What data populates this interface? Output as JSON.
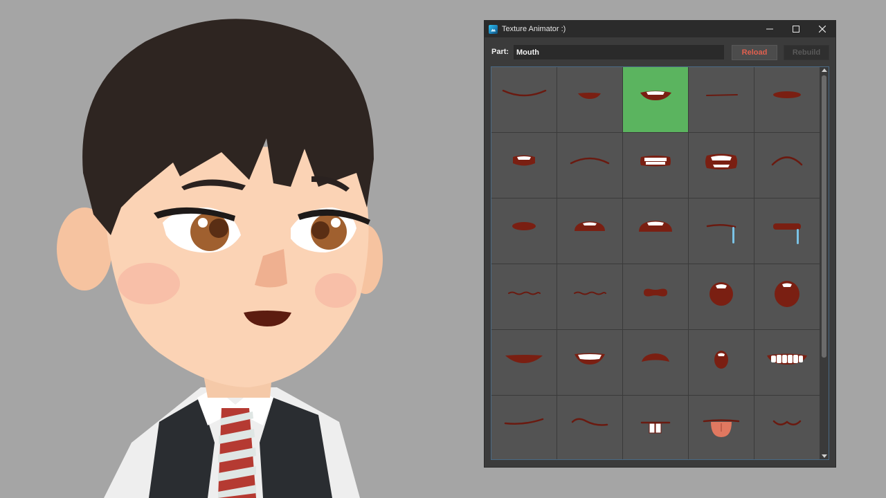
{
  "window": {
    "title": "Texture Animator :)",
    "minimize_icon": "minimize-icon",
    "maximize_icon": "maximize-icon",
    "close_icon": "close-icon"
  },
  "toolbar": {
    "part_label": "Part:",
    "part_value": "Mouth",
    "reload_label": "Reload",
    "rebuild_label": "Rebuild"
  },
  "mouth_grid": {
    "columns": 5,
    "selected_index": 2,
    "cells": [
      "smile-line",
      "small-closed",
      "open-smile-teeth",
      "flat-line",
      "oval-closed",
      "small-open-teeth",
      "frown-line",
      "teeth-grin",
      "grimace-teeth",
      "frown-arc",
      "small-oval",
      "open-upper-teeth",
      "wide-open-teeth",
      "flat-drool",
      "closed-drool",
      "wavy-line",
      "wavy-line-2",
      "pucker",
      "round-open",
      "big-round-open",
      "wide-smile",
      "smile-teeth",
      "pout",
      "small-round-open",
      "big-grin-teeth",
      "smirk-line",
      "wavy-smirk",
      "buck-teeth",
      "tongue-out",
      "cat-mouth"
    ]
  },
  "colors": {
    "background": "#a5a5a5",
    "window_bg": "#3b3b3b",
    "cell_bg": "#535353",
    "selected_cell": "#5bb45f",
    "reload_text": "#e2604f",
    "mouth_fill": "#7a1f12"
  }
}
